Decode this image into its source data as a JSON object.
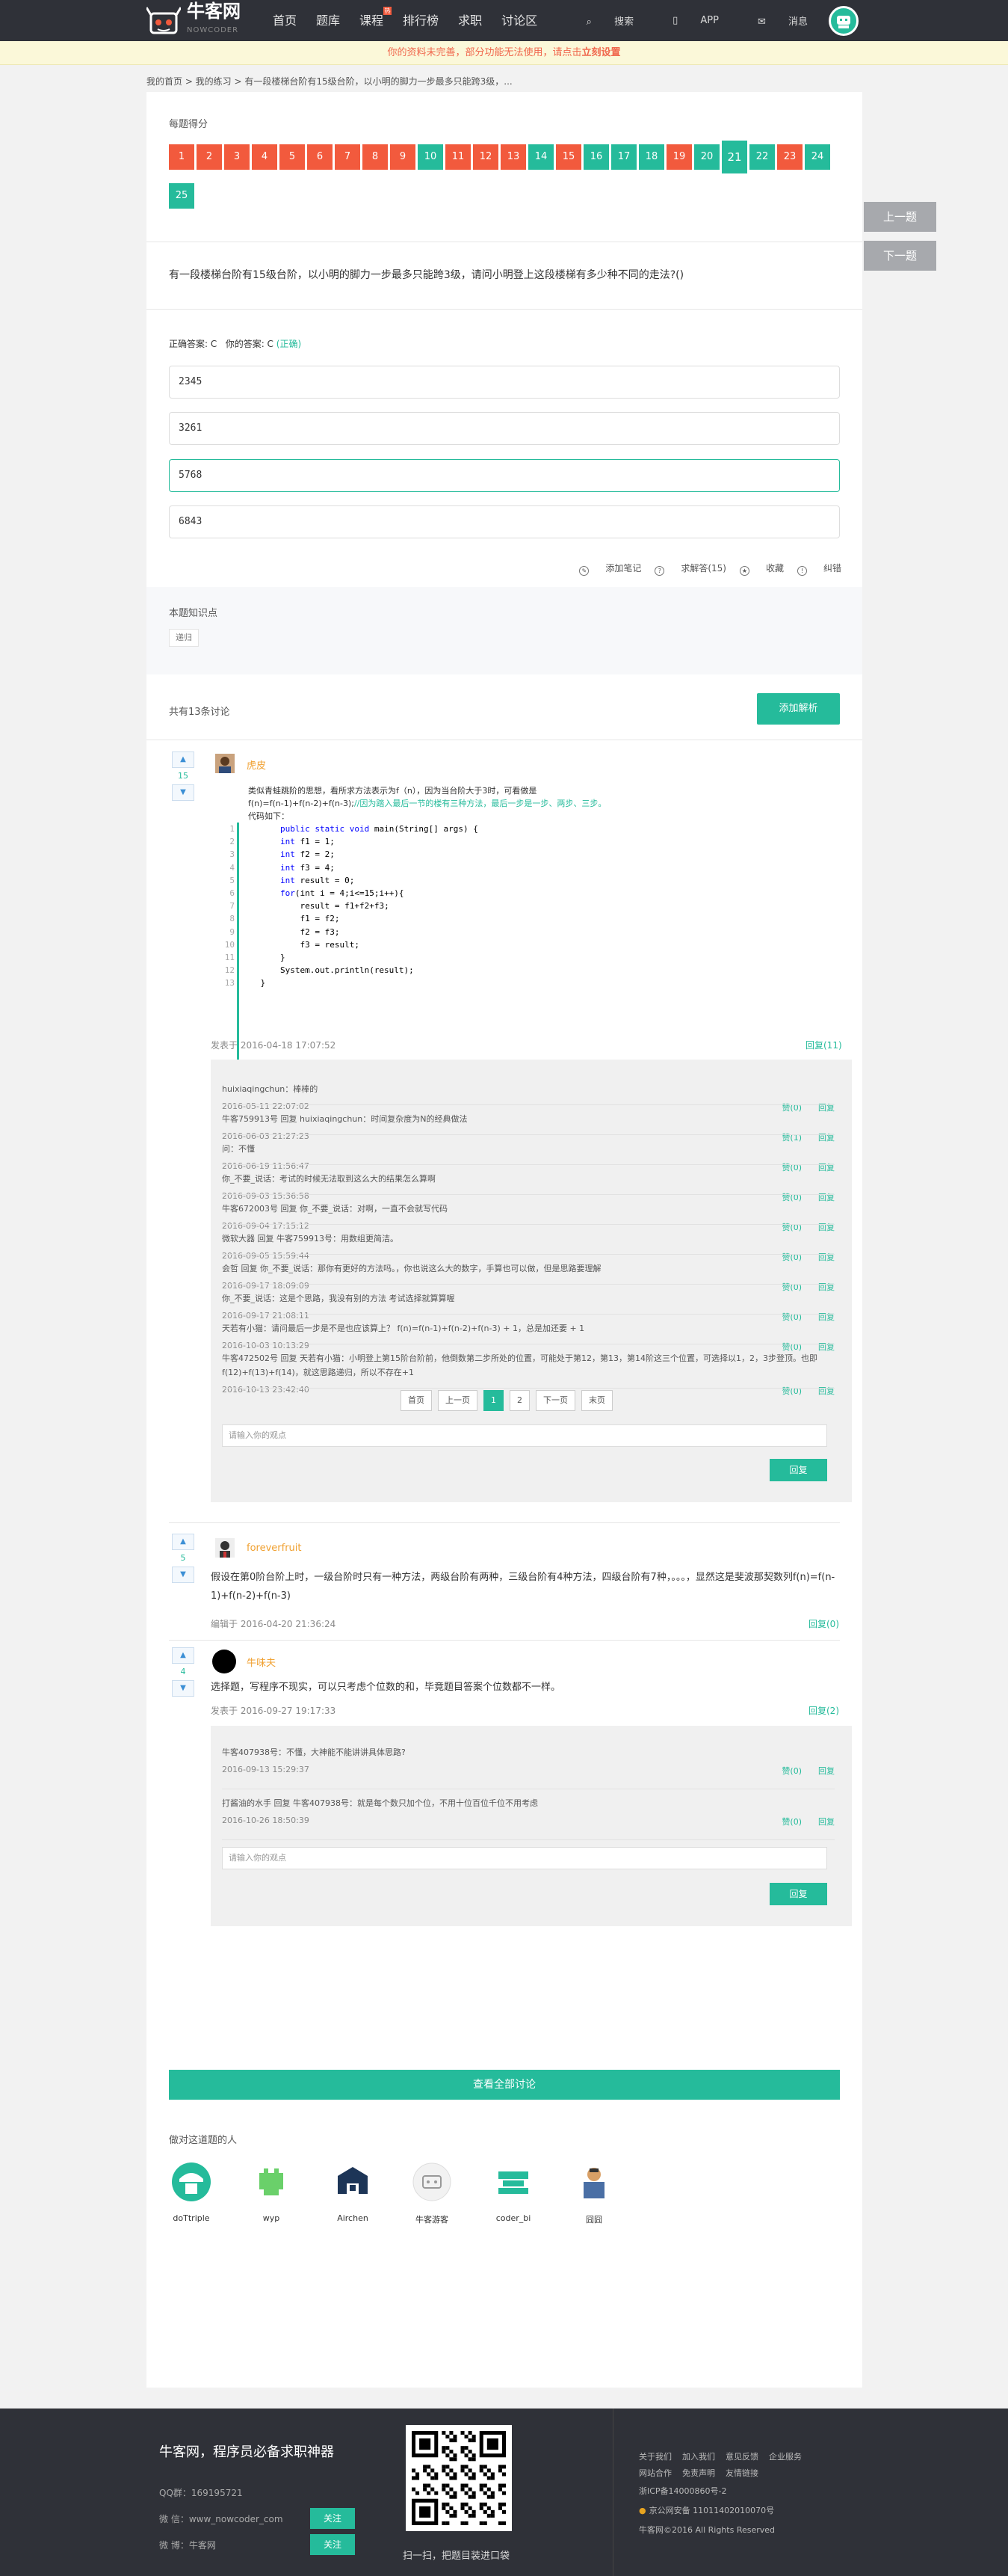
{
  "header": {
    "logo_title": "牛客网",
    "logo_sub": "NOWCODER",
    "nav": [
      "首页",
      "题库",
      "课程",
      "排行榜",
      "求职",
      "讨论区"
    ],
    "hot_badge": "热",
    "search": "搜索",
    "app": "APP",
    "message": "消息"
  },
  "notice": {
    "text": "你的资料未完善，部分功能无法使用，请点击",
    "link": "立刻设置"
  },
  "breadcrumb": "我的首页 > 我的练习 > 有一段楼梯台阶有15级台阶，以小明的脚力一步最多只能跨3级，...",
  "score_title": "每题得分",
  "questions": [
    {
      "n": "1",
      "s": "w"
    },
    {
      "n": "2",
      "s": "w"
    },
    {
      "n": "3",
      "s": "w"
    },
    {
      "n": "4",
      "s": "w"
    },
    {
      "n": "5",
      "s": "w"
    },
    {
      "n": "6",
      "s": "w"
    },
    {
      "n": "7",
      "s": "w"
    },
    {
      "n": "8",
      "s": "w"
    },
    {
      "n": "9",
      "s": "w"
    },
    {
      "n": "10",
      "s": "r"
    },
    {
      "n": "11",
      "s": "w"
    },
    {
      "n": "12",
      "s": "w"
    },
    {
      "n": "13",
      "s": "w"
    },
    {
      "n": "14",
      "s": "r"
    },
    {
      "n": "15",
      "s": "w"
    },
    {
      "n": "16",
      "s": "r"
    },
    {
      "n": "17",
      "s": "r"
    },
    {
      "n": "18",
      "s": "r"
    },
    {
      "n": "19",
      "s": "w"
    },
    {
      "n": "20",
      "s": "r"
    },
    {
      "n": "21",
      "s": "r"
    },
    {
      "n": "22",
      "s": "r"
    },
    {
      "n": "23",
      "s": "w"
    },
    {
      "n": "24",
      "s": "r"
    },
    {
      "n": "25",
      "s": "r"
    }
  ],
  "prev_btn": "上一题",
  "next_btn": "下一题",
  "question_text": "有一段楼梯台阶有15级台阶，以小明的脚力一步最多只能跨3级，请问小明登上这段楼梯有多少种不同的走法?()",
  "answer": {
    "correct_label": "正确答案: C",
    "yours_label": "你的答案: C",
    "status": "(正确)"
  },
  "options": [
    "2345",
    "3261",
    "5768",
    "6843"
  ],
  "tools": [
    "添加笔记",
    "求解答(15)",
    "收藏",
    "纠错"
  ],
  "knowledge": {
    "title": "本题知识点",
    "tag": "递归"
  },
  "discussion": {
    "count": "共有13条讨论",
    "add_btn": "添加解析"
  },
  "post1": {
    "votes": "15",
    "user": "虎皮",
    "intro": "类似青蛙跳阶的思想，看所求方法表示为f（n），因为当台阶大于3时，可看做是",
    "formula": "f(n)=f(n-1)+f(n-2)+f(n-3);",
    "formula_comment": "//因为踏入最后一节的楼有三种方法，最后一步是一步、两步、三步。",
    "code_label": "代码如下：",
    "code": [
      {
        "ln": "1",
        "pre": "        ",
        "kw": "public static void ",
        "rest": "main(String[] args) {"
      },
      {
        "ln": "2",
        "pre": "        ",
        "kw": "int ",
        "rest": "f1 = 1;"
      },
      {
        "ln": "3",
        "pre": "        ",
        "kw": "int ",
        "rest": "f2 = 2;"
      },
      {
        "ln": "4",
        "pre": "        ",
        "kw": "int ",
        "rest": "f3 = 4;"
      },
      {
        "ln": "5",
        "pre": "        ",
        "kw": "int ",
        "rest": "result = 0;"
      },
      {
        "ln": "6",
        "pre": "        ",
        "kw": "for",
        "rest": "(int i = 4;i<=15;i++){"
      },
      {
        "ln": "7",
        "pre": "            ",
        "kw": "",
        "rest": "result = f1+f2+f3;"
      },
      {
        "ln": "8",
        "pre": "            ",
        "kw": "",
        "rest": "f1 = f2;"
      },
      {
        "ln": "9",
        "pre": "            ",
        "kw": "",
        "rest": "f2 = f3;"
      },
      {
        "ln": "10",
        "pre": "            ",
        "kw": "",
        "rest": "f3 = result;"
      },
      {
        "ln": "11",
        "pre": "        ",
        "kw": "",
        "rest": "}"
      },
      {
        "ln": "12",
        "pre": "        ",
        "kw": "",
        "rest": "System.out.println(result);"
      },
      {
        "ln": "13",
        "pre": "    ",
        "kw": "",
        "rest": "}"
      }
    ],
    "meta": "发表于 2016-04-18 17:07:52",
    "reply": "回复(11)",
    "replies": [
      {
        "text": "huixiaqingchun：棒棒的",
        "time": "2016-05-11 22:07:02",
        "like": "赞(0)",
        "reply": "回复"
      },
      {
        "text": "牛客759913号 回复 huixiaqingchun：时间复杂度为N的经典做法",
        "time": "2016-06-03 21:27:23",
        "like": "赞(1)",
        "reply": "回复"
      },
      {
        "text": "问：不懂",
        "time": "2016-06-19 11:56:47",
        "like": "赞(0)",
        "reply": "回复"
      },
      {
        "text": "你_不要_说话：考试的时候无法取到这么大的结果怎么算啊",
        "time": "2016-09-03 15:36:58",
        "like": "赞(0)",
        "reply": "回复"
      },
      {
        "text": "牛客672003号 回复 你_不要_说话：对啊，一直不会就写代码",
        "time": "2016-09-04 17:15:12",
        "like": "赞(0)",
        "reply": "回复"
      },
      {
        "text": "微软大器 回复 牛客759913号：用数组更简洁。",
        "time": "2016-09-05 15:59:44",
        "like": "赞(0)",
        "reply": "回复"
      },
      {
        "text": "会哲 回复 你_不要_说话：那你有更好的方法吗。，你也说这么大的数字，手算也可以做，但是思路要理解",
        "time": "2016-09-17 18:09:09",
        "like": "赞(0)",
        "reply": "回复"
      },
      {
        "text": "你_不要_说话：这是个思路，我没有别的方法 考试选择就算算喔",
        "time": "2016-09-17 21:08:11",
        "like": "赞(0)",
        "reply": "回复"
      },
      {
        "text": "天若有小猫：请问最后一步是不是也应该算上？ f(n)=f(n-1)+f(n-2)+f(n-3) + 1，总是加还要 + 1",
        "time": "2016-10-03 10:13:29",
        "like": "赞(0)",
        "reply": "回复"
      },
      {
        "text": "牛客472502号 回复 天若有小猫：小明登上第15阶台阶前，他倒数第二步所处的位置，可能处于第12，第13，第14阶这三个位置，可选择以1，2，3步登顶。也即f(12)+f(13)+f(14)，就这思路递归，所以不存在+1",
        "time": "2016-10-13 23:42:40",
        "like": "赞(0)",
        "reply": "回复"
      }
    ],
    "pager": [
      "首页",
      "上一页",
      "1",
      "2",
      "下一页",
      "末页"
    ],
    "reply_placeholder": "请输入你的观点",
    "reply_btn": "回复"
  },
  "post2": {
    "votes": "5",
    "user": "foreverfruit",
    "text": "假设在第0阶台阶上时，一级台阶时只有一种方法，两级台阶有两种，三级台阶有4种方法，四级台阶有7种，。。。，显然这是斐波那契数列f(n)=f(n-1)+f(n-2)+f(n-3)",
    "meta": "编辑于 2016-04-20 21:36:24",
    "reply": "回复(0)"
  },
  "post3": {
    "votes": "4",
    "user": "牛味夫",
    "text": "选择题，写程序不现实，可以只考虑个位数的和，毕竟题目答案个位数都不一样。",
    "meta": "发表于 2016-09-27 19:17:33",
    "reply": "回复(2)",
    "replies": [
      {
        "text": "牛客407938号：不懂，大神能不能讲讲具体思路?",
        "time": "2016-09-13 15:29:37",
        "like": "赞(0)",
        "reply": "回复"
      },
      {
        "text": "打酱油的水手 回复 牛客407938号：就是每个数只加个位，不用十位百位千位不用考虑",
        "time": "2016-10-26 18:50:39",
        "like": "赞(0)",
        "reply": "回复"
      }
    ],
    "reply_placeholder": "请输入你的观点",
    "reply_btn": "回复"
  },
  "view_all": "查看全部讨论",
  "doers_title": "做对这道题的人",
  "doers": [
    {
      "name": "doTtriple"
    },
    {
      "name": "wyp"
    },
    {
      "name": "Airchen"
    },
    {
      "name": "牛客游客"
    },
    {
      "name": "coder_bi"
    },
    {
      "name": "囧囧"
    }
  ],
  "footer": {
    "title": "牛客网，程序员必备求职神器",
    "qq": "QQ群：169195721",
    "weibo1": "微 信：www_nowcoder_com",
    "weibo2": "微 博：牛客网",
    "follow": "关注",
    "qr_caption": "扫一扫，把题目装进口袋",
    "links1": [
      "关于我们",
      "加入我们",
      "意见反馈",
      "企业服务"
    ],
    "links2": [
      "网站合作",
      "免责声明",
      "友情链接"
    ],
    "icp": "浙ICP备14000860号-2",
    "police": "京公网安备 11011402010070号",
    "copyright": "牛客网©2016 All Rights Reserved"
  },
  "colors": {
    "accent": "#25bb9b",
    "wrong": "#f25a3d",
    "header": "#2f3138"
  }
}
